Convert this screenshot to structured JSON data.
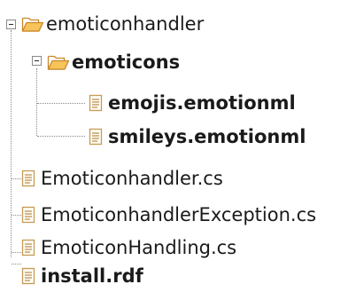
{
  "tree": {
    "root": {
      "label": "emoticonhandler",
      "icon": "folder-open-icon",
      "expanded": true,
      "children": {
        "emoticons": {
          "label": "emoticons",
          "icon": "folder-open-icon",
          "expanded": true,
          "files": [
            {
              "label": "emojis.emotionml",
              "icon": "file-icon"
            },
            {
              "label": "smileys.emotionml",
              "icon": "file-icon"
            }
          ]
        },
        "files": [
          {
            "label": "Emoticonhandler.cs",
            "icon": "file-icon"
          },
          {
            "label": "EmoticonhandlerException.cs",
            "icon": "file-icon"
          },
          {
            "label": "EmoticonHandling.cs",
            "icon": "file-icon"
          },
          {
            "label": "install.rdf",
            "icon": "file-icon"
          }
        ]
      }
    }
  },
  "colors": {
    "folder_fill": "#f7c35b",
    "folder_stroke": "#c9862a",
    "file_stroke": "#c79a55",
    "file_lines": "#b58a48",
    "connector": "#8c8c8c"
  }
}
